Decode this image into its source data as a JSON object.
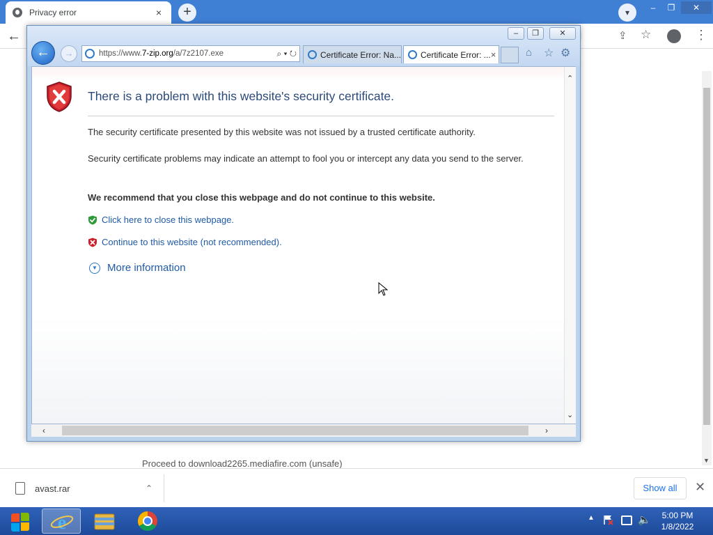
{
  "chrome": {
    "tab_title": "Privacy error",
    "tab_close": "×",
    "new_tab": "+",
    "proceed_text": "Proceed to download2265.mediafire.com (unsafe)"
  },
  "ie": {
    "url_prefix": "https://www.",
    "url_domain": "7-zip.org",
    "url_rest": "/a/7z2107.exe",
    "address_tools": "⌕ ▾ ↻",
    "tabs": [
      {
        "label": "Certificate Error: Na..."
      },
      {
        "label": "Certificate Error: ..."
      }
    ],
    "tab_close": "×",
    "content": {
      "heading": "There is a problem with this website's security certificate.",
      "p1": "The security certificate presented by this website was not issued by a trusted certificate authority.",
      "p2": "Security certificate problems may indicate an attempt to fool you or intercept any data you send to the server.",
      "recommend": "We recommend that you close this webpage and do not continue to this website.",
      "close_link": "Click here to close this webpage.",
      "continue_link": "Continue to this website (not recommended).",
      "more_info": "More information"
    }
  },
  "download_bar": {
    "file_name": "avast.rar",
    "show_all": "Show all"
  },
  "taskbar": {
    "time": "5:00 PM",
    "date": "1/8/2022"
  },
  "colors": {
    "chrome_blue": "#3f7fd4",
    "link_blue": "#1f5aa6",
    "heading_blue": "#2b4a78",
    "error_red": "#c8202b",
    "safe_green": "#2f9a3a"
  }
}
